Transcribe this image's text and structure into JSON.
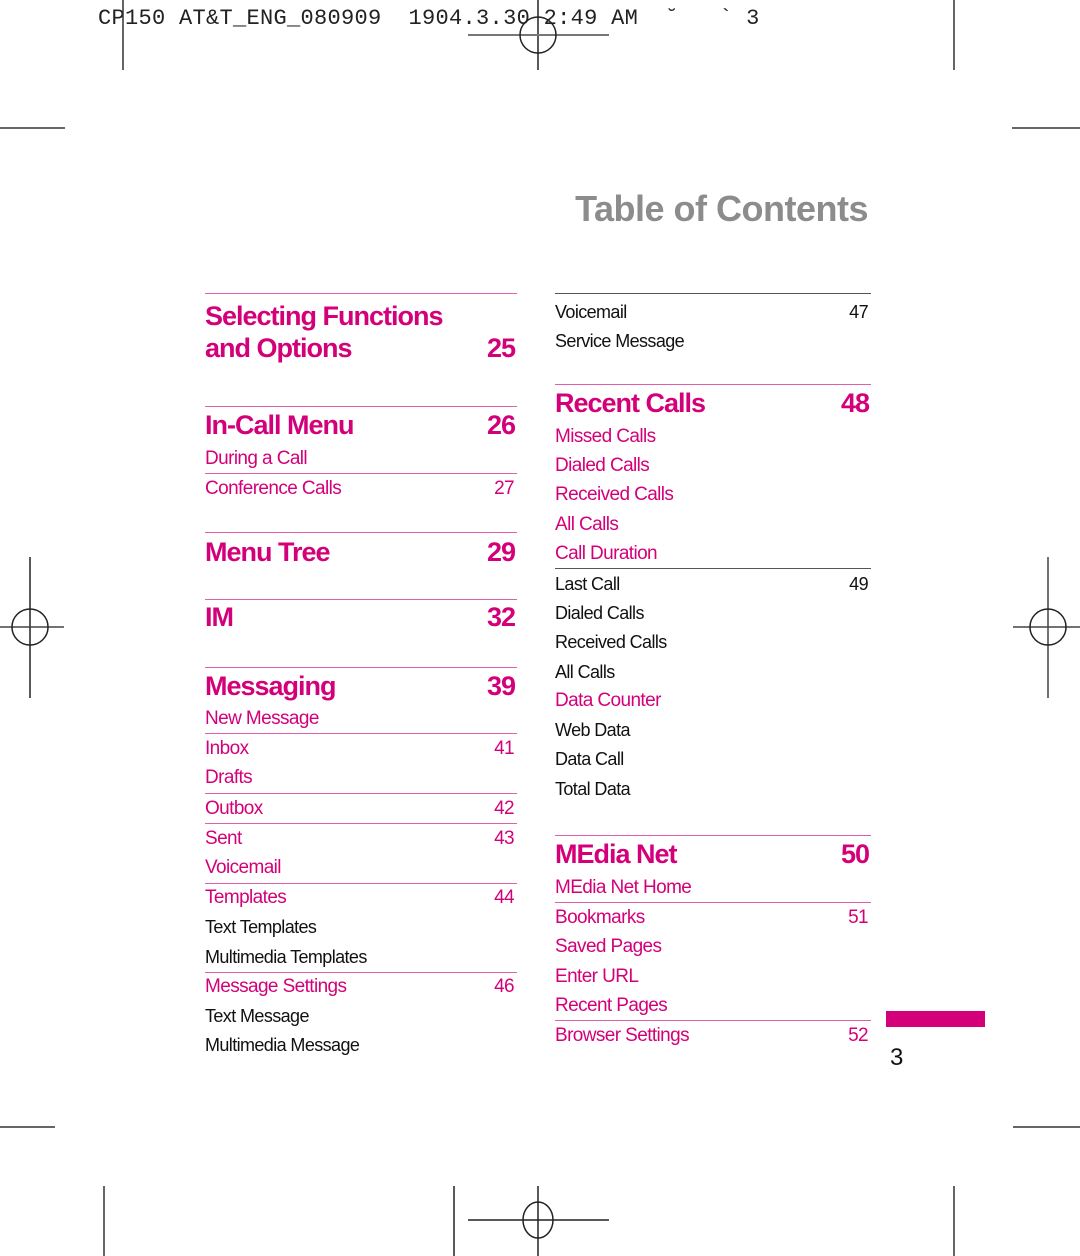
{
  "slug": {
    "text": "CP150 AT&T_ENG_080909  1904.3.30 2:49 AM  ˘   ` 3"
  },
  "header": {
    "title": "Table of Contents"
  },
  "colors": {
    "accent": "#d4007a",
    "title_gray": "#8c8c8c",
    "text": "#111111"
  },
  "left_column": {
    "selecting": {
      "title_line1": "Selecting Functions",
      "title_line2": "and Options",
      "page": "25"
    },
    "incall": {
      "title": "In-Call Menu",
      "page": "26",
      "items": [
        {
          "label": "During a Call",
          "page": ""
        },
        {
          "label": "Conference Calls",
          "page": "27"
        }
      ]
    },
    "menutree": {
      "title": "Menu Tree",
      "page": "29"
    },
    "im": {
      "title": "IM",
      "page": "32"
    },
    "messaging": {
      "title": "Messaging",
      "page": "39",
      "items": [
        {
          "label": "New Message",
          "page": ""
        },
        {
          "label": "Inbox",
          "page": "41"
        },
        {
          "label": "Drafts",
          "page": ""
        },
        {
          "label": "Outbox",
          "page": "42"
        },
        {
          "label": "Sent",
          "page": "43"
        },
        {
          "label": "Voicemail",
          "page": ""
        },
        {
          "label": "Templates",
          "page": "44"
        },
        {
          "label": "Text Templates",
          "page": ""
        },
        {
          "label": "Multimedia Templates",
          "page": ""
        },
        {
          "label": "Message Settings",
          "page": "46"
        },
        {
          "label": "Text Message",
          "page": ""
        },
        {
          "label": "Multimedia Message",
          "page": ""
        }
      ]
    }
  },
  "right_column": {
    "continued": {
      "items": [
        {
          "label": "Voicemail",
          "page": "47"
        },
        {
          "label": "Service Message",
          "page": ""
        }
      ]
    },
    "recent": {
      "title": "Recent Calls",
      "page": "48",
      "items": [
        {
          "label": "Missed Calls",
          "page": ""
        },
        {
          "label": "Dialed Calls",
          "page": ""
        },
        {
          "label": "Received Calls",
          "page": ""
        },
        {
          "label": "All Calls",
          "page": ""
        },
        {
          "label": "Call Duration",
          "page": ""
        },
        {
          "label": "Last Call",
          "page": "49"
        },
        {
          "label": "Dialed Calls",
          "page": ""
        },
        {
          "label": "Received Calls",
          "page": ""
        },
        {
          "label": "All Calls",
          "page": ""
        },
        {
          "label": "Data Counter",
          "page": ""
        },
        {
          "label": "Web Data",
          "page": ""
        },
        {
          "label": "Data Call",
          "page": ""
        },
        {
          "label": "Total Data",
          "page": ""
        }
      ]
    },
    "medianet": {
      "title": "MEdia Net",
      "page": "50",
      "items": [
        {
          "label": "MEdia Net Home",
          "page": ""
        },
        {
          "label": "Bookmarks",
          "page": "51"
        },
        {
          "label": "Saved Pages",
          "page": ""
        },
        {
          "label": "Enter URL",
          "page": ""
        },
        {
          "label": "Recent Pages",
          "page": ""
        },
        {
          "label": "Browser Settings",
          "page": "52"
        }
      ]
    }
  },
  "footer": {
    "page_number": "3"
  }
}
